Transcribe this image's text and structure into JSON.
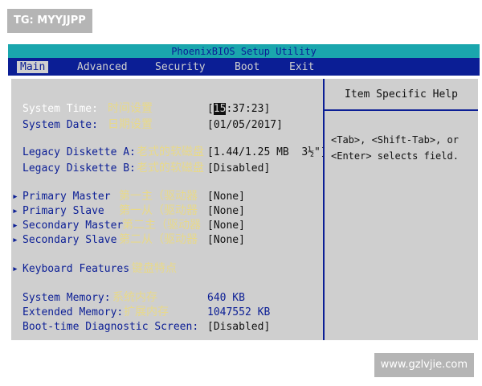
{
  "watermarks": {
    "top": "TG: MYYJJPP",
    "bottom": "www.gzlvjie.com"
  },
  "title": "PhoenixBIOS Setup Utility",
  "menu": [
    {
      "label": "Main",
      "active": true
    },
    {
      "label": "Advanced",
      "active": false
    },
    {
      "label": "Security",
      "active": false
    },
    {
      "label": "Boot",
      "active": false
    },
    {
      "label": "Exit",
      "active": false
    }
  ],
  "main": {
    "system_time": {
      "label": "System Time:",
      "note": "时间设置",
      "value_hour": "15",
      "value_rest": ":37:23]",
      "bracket": "["
    },
    "system_date": {
      "label": "System Date:",
      "note": "日期设置",
      "value": "[01/05/2017]"
    },
    "diskette_a": {
      "label": "Legacy Diskette A:",
      "note": "老式的软磁盘",
      "value": "[1.44/1.25 MB  3½\"]"
    },
    "diskette_b": {
      "label": "Legacy Diskette B:",
      "note": "老式的软磁盘",
      "value": "[Disabled]"
    },
    "submenu_arrow": "▸",
    "drives": [
      {
        "label": "Primary Master",
        "note": "第一主（驱动器",
        "value": "[None]"
      },
      {
        "label": "Primary Slave",
        "note": "第一从（驱动器",
        "value": "[None]"
      },
      {
        "label": "Secondary Master",
        "note": "第二主（驱动器",
        "value": "[None]"
      },
      {
        "label": "Secondary Slave",
        "note": "第二从（驱动器",
        "value": "[None]"
      }
    ],
    "keyboard": {
      "label": "Keyboard Features",
      "note": "键盘特点"
    },
    "system_memory": {
      "label": "System Memory:",
      "note": "系统内存",
      "value": "640 KB"
    },
    "extended_memory": {
      "label": "Extended Memory:",
      "note": "扩展内存",
      "value": "1047552 KB"
    },
    "diagnostic": {
      "label": "Boot-time Diagnostic Screen:",
      "value": "[Disabled]"
    }
  },
  "help": {
    "title": "Item Specific Help",
    "text": "<Tab>, <Shift-Tab>, or\n<Enter> selects field."
  },
  "colors": {
    "bios_blue": "#0b1e95",
    "title_teal": "#1aa6ad",
    "panel_gray": "#cfcfcf",
    "note_yellow": "#e8d98a"
  }
}
